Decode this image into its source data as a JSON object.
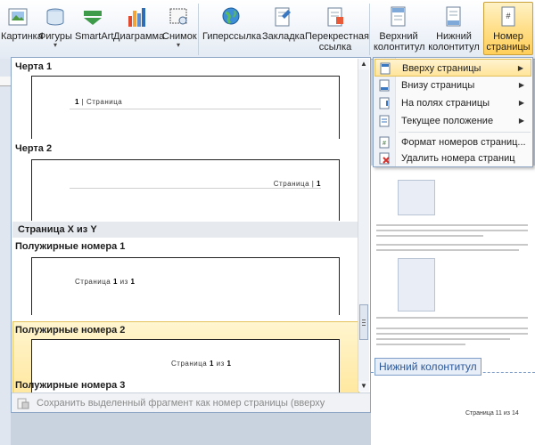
{
  "ribbon": {
    "buttons": [
      {
        "label": "Картинка",
        "label2": "",
        "has_arrow": false
      },
      {
        "label": "Фигуры",
        "label2": "",
        "has_arrow": true
      },
      {
        "label": "SmartArt",
        "label2": "",
        "has_arrow": false
      },
      {
        "label": "Диаграмма",
        "label2": "",
        "has_arrow": false
      },
      {
        "label": "Снимок",
        "label2": "",
        "has_arrow": true
      },
      {
        "label": "Гиперссылка",
        "label2": "",
        "has_arrow": false
      },
      {
        "label": "Закладка",
        "label2": "",
        "has_arrow": false
      },
      {
        "label": "Перекрестная",
        "label2": "ссылка",
        "has_arrow": false
      },
      {
        "label": "Верхний",
        "label2": "колонтитул",
        "has_arrow": true
      },
      {
        "label": "Нижний",
        "label2": "колонтитул",
        "has_arrow": true
      },
      {
        "label": "Номер",
        "label2": "страницы",
        "has_arrow": true
      }
    ],
    "arrow_glyph": "▾"
  },
  "gallery": {
    "items": [
      {
        "title": "Черта 1",
        "preview_html_num": "1",
        "preview_text": " | Страница"
      },
      {
        "title": "Черта 2",
        "preview_text": "Страница | ",
        "preview_num": "1"
      },
      {
        "title": "Полужирные номера 1",
        "p1": "Страница ",
        "n1": "1",
        "p2": " из ",
        "n2": "1"
      },
      {
        "title": "Полужирные номера 2",
        "p1": "Страница ",
        "n1": "1",
        "p2": " из ",
        "n2": "1"
      },
      {
        "title": "Полужирные номера 3"
      }
    ],
    "section_header": "Страница X из Y",
    "footer_text": "Сохранить выделенный фрагмент как номер страницы (вверху страницы)",
    "scroll_up": "▲",
    "scroll_down": "▼"
  },
  "menu": {
    "items": [
      {
        "label": "Вверху страницы",
        "submenu": true
      },
      {
        "label": "Внизу страницы",
        "submenu": true
      },
      {
        "label": "На полях страницы",
        "submenu": true
      },
      {
        "label": "Текущее положение",
        "submenu": true
      },
      {
        "label": "Формат номеров страниц...",
        "submenu": false
      },
      {
        "label": "Удалить номера страниц",
        "submenu": false
      }
    ],
    "submenu_glyph": "▶"
  },
  "document": {
    "footer_tag": "Нижний колонтитул",
    "page_number_text": "Страница 11 из 14"
  },
  "colors": {
    "highlight": "#ffe49a",
    "accent": "#2b5797"
  }
}
